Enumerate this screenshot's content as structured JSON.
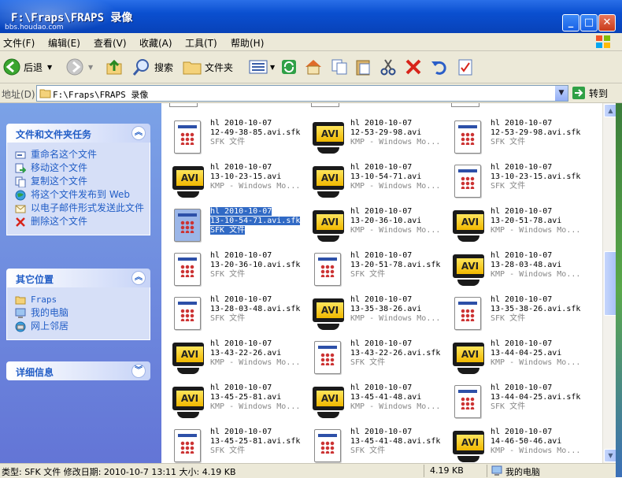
{
  "window": {
    "title": "F:\\Fraps\\FRAPS 录像",
    "watermark_sub": "bbs.houdao.com",
    "min": "_",
    "max": "□",
    "close": "✕"
  },
  "menu": [
    "文件(F)",
    "编辑(E)",
    "查看(V)",
    "收藏(A)",
    "工具(T)",
    "帮助(H)"
  ],
  "toolbar": {
    "back": "后退",
    "search": "搜索",
    "folders": "文件夹"
  },
  "address": {
    "label": "地址(D)",
    "value": "F:\\Fraps\\FRAPS 录像",
    "go": "转到"
  },
  "tasks": {
    "title": "文件和文件夹任务",
    "items": [
      "重命名这个文件",
      "移动这个文件",
      "复制这个文件",
      "将这个文件发布到 Web",
      "以电子邮件形式发送此文件",
      "删除这个文件"
    ]
  },
  "places": {
    "title": "其它位置",
    "items": [
      "Fraps",
      "我的电脑",
      "网上邻居"
    ]
  },
  "details": {
    "title": "详细信息"
  },
  "files": [
    {
      "l1": "hl 2010-10-07",
      "l2": "12-49-38-85.avi.sfk",
      "l3": "SFK 文件",
      "type": "sfk"
    },
    {
      "l1": "hl 2010-10-07",
      "l2": "12-53-29-98.avi",
      "l3": "KMP - Windows Mo...",
      "type": "avi"
    },
    {
      "l1": "hl 2010-10-07",
      "l2": "12-53-29-98.avi.sfk",
      "l3": "SFK 文件",
      "type": "sfk"
    },
    {
      "l1": "hl 2010-10-07",
      "l2": "13-10-23-15.avi",
      "l3": "KMP - Windows Mo...",
      "type": "avi"
    },
    {
      "l1": "hl 2010-10-07",
      "l2": "13-10-54-71.avi",
      "l3": "KMP - Windows Mo...",
      "type": "avi"
    },
    {
      "l1": "hl 2010-10-07",
      "l2": "13-10-23-15.avi.sfk",
      "l3": "SFK 文件",
      "type": "sfk"
    },
    {
      "l1": "hl 2010-10-07",
      "l2": "13-10-54-71.avi.sfk",
      "l3": "SFK 文件",
      "type": "sfk",
      "selected": true
    },
    {
      "l1": "hl 2010-10-07",
      "l2": "13-20-36-10.avi",
      "l3": "KMP - Windows Mo...",
      "type": "avi"
    },
    {
      "l1": "hl 2010-10-07",
      "l2": "13-20-51-78.avi",
      "l3": "KMP - Windows Mo...",
      "type": "avi"
    },
    {
      "l1": "hl 2010-10-07",
      "l2": "13-20-36-10.avi.sfk",
      "l3": "SFK 文件",
      "type": "sfk"
    },
    {
      "l1": "hl 2010-10-07",
      "l2": "13-20-51-78.avi.sfk",
      "l3": "SFK 文件",
      "type": "sfk"
    },
    {
      "l1": "hl 2010-10-07",
      "l2": "13-28-03-48.avi",
      "l3": "KMP - Windows Mo...",
      "type": "avi"
    },
    {
      "l1": "hl 2010-10-07",
      "l2": "13-28-03-48.avi.sfk",
      "l3": "SFK 文件",
      "type": "sfk"
    },
    {
      "l1": "hl 2010-10-07",
      "l2": "13-35-38-26.avi",
      "l3": "KMP - Windows Mo...",
      "type": "avi"
    },
    {
      "l1": "hl 2010-10-07",
      "l2": "13-35-38-26.avi.sfk",
      "l3": "SFK 文件",
      "type": "sfk"
    },
    {
      "l1": "hl 2010-10-07",
      "l2": "13-43-22-26.avi",
      "l3": "KMP - Windows Mo...",
      "type": "avi"
    },
    {
      "l1": "hl 2010-10-07",
      "l2": "13-43-22-26.avi.sfk",
      "l3": "SFK 文件",
      "type": "sfk"
    },
    {
      "l1": "hl 2010-10-07",
      "l2": "13-44-04-25.avi",
      "l3": "KMP - Windows Mo...",
      "type": "avi"
    },
    {
      "l1": "hl 2010-10-07",
      "l2": "13-45-25-81.avi",
      "l3": "KMP - Windows Mo...",
      "type": "avi"
    },
    {
      "l1": "hl 2010-10-07",
      "l2": "13-45-41-48.avi",
      "l3": "KMP - Windows Mo...",
      "type": "avi"
    },
    {
      "l1": "hl 2010-10-07",
      "l2": "13-44-04-25.avi.sfk",
      "l3": "SFK 文件",
      "type": "sfk"
    },
    {
      "l1": "hl 2010-10-07",
      "l2": "13-45-25-81.avi.sfk",
      "l3": "SFK 文件",
      "type": "sfk"
    },
    {
      "l1": "hl 2010-10-07",
      "l2": "13-45-41-48.avi.sfk",
      "l3": "SFK 文件",
      "type": "sfk"
    },
    {
      "l1": "hl 2010-10-07",
      "l2": "14-46-50-46.avi",
      "l3": "KMP - Windows Mo...",
      "type": "avi"
    }
  ],
  "avi_label": "AVI",
  "status": {
    "info": "类型: SFK 文件 修改日期: 2010-10-7 13:11 大小: 4.19 KB",
    "size": "4.19 KB",
    "location": "我的电脑"
  }
}
